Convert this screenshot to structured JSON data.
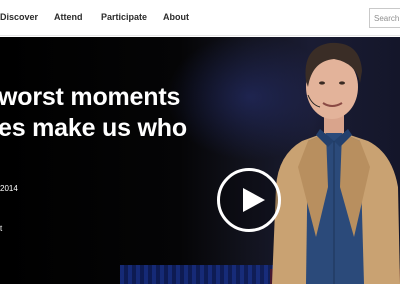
{
  "nav": {
    "items": [
      {
        "label": "Discover"
      },
      {
        "label": "Attend"
      },
      {
        "label": "Participate"
      },
      {
        "label": "About"
      }
    ],
    "search_placeholder": "Search..."
  },
  "hero": {
    "title_line1": "worst moments",
    "title_line2": "es make us who",
    "meta_date": "2014",
    "meta_extra": "t",
    "play_icon": "play-icon"
  },
  "colors": {
    "nav_text": "#2b2b2b",
    "hero_text": "#ffffff",
    "blazer": "#c9a272",
    "shirt": "#2b4a7a"
  }
}
